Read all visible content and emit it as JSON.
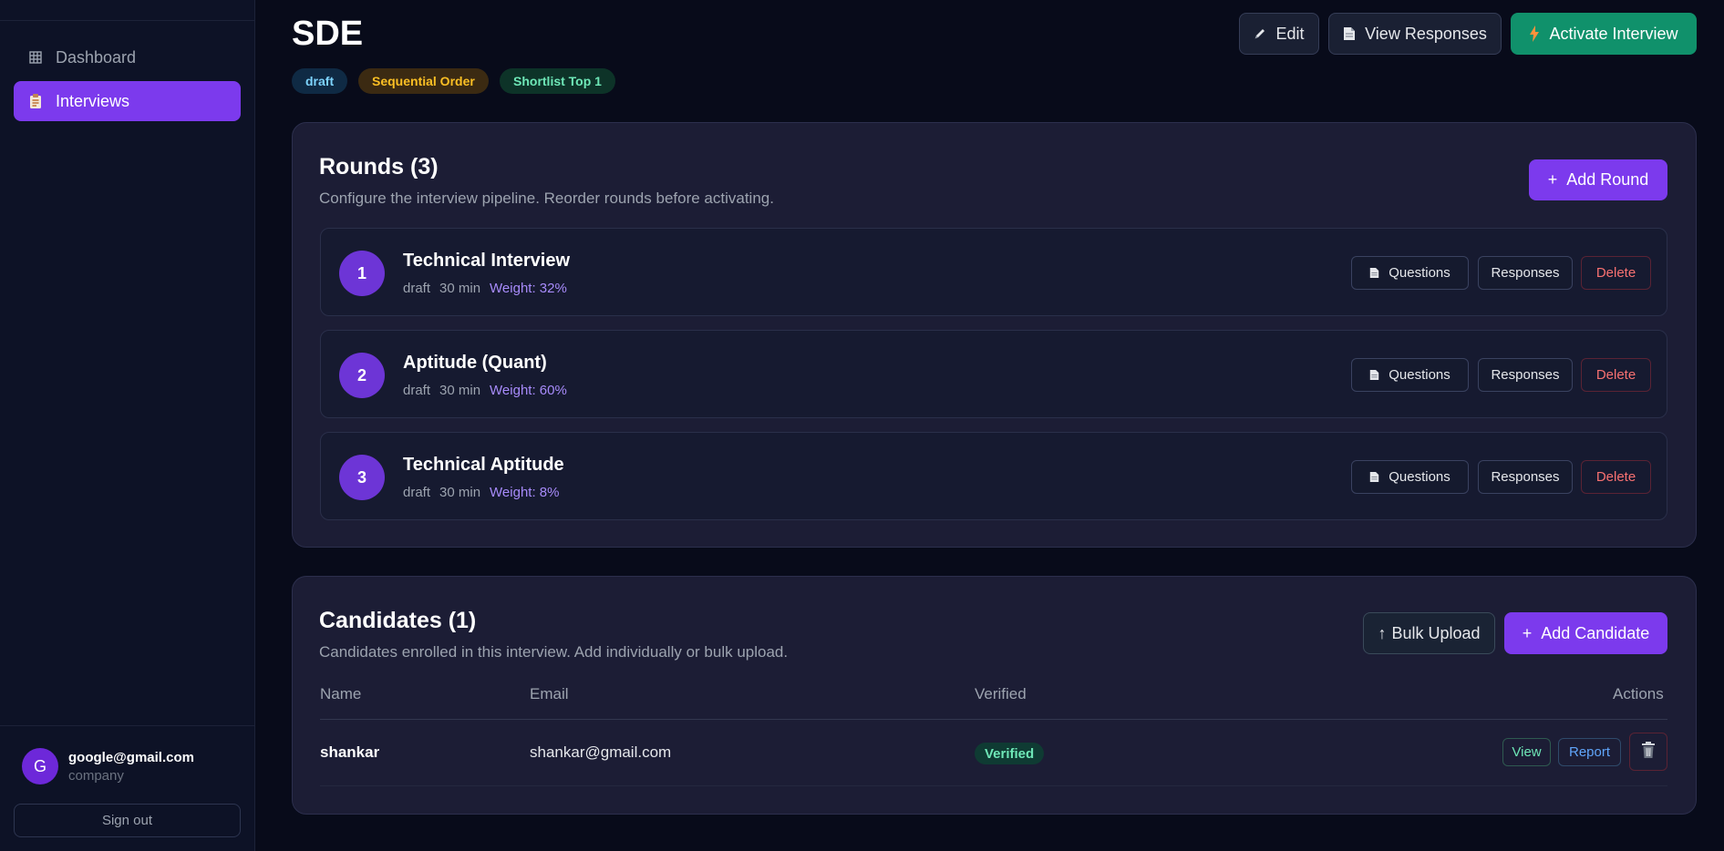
{
  "sidebar": {
    "items": [
      {
        "label": "Dashboard",
        "icon": "grid-icon",
        "active": false
      },
      {
        "label": "Interviews",
        "icon": "clipboard-icon",
        "active": true
      }
    ],
    "user": {
      "initial": "G",
      "email": "google@gmail.com",
      "role": "company"
    },
    "signout_label": "Sign out"
  },
  "header": {
    "title": "SDE",
    "badges": [
      "draft",
      "Sequential Order",
      "Shortlist Top 1"
    ],
    "edit_label": "Edit",
    "view_label": "View Responses",
    "activate_label": "Activate Interview"
  },
  "rounds": {
    "title": "Rounds (3)",
    "subtitle": "Configure the interview pipeline. Reorder rounds before activating.",
    "add_label": "Add Round",
    "add_icon": "+",
    "items": [
      {
        "num": "1",
        "name": "Technical Interview",
        "status": "draft",
        "duration": "30 min",
        "weight": "Weight: 32%"
      },
      {
        "num": "2",
        "name": "Aptitude (Quant)",
        "status": "draft",
        "duration": "30 min",
        "weight": "Weight: 60%"
      },
      {
        "num": "3",
        "name": "Technical Aptitude",
        "status": "draft",
        "duration": "30 min",
        "weight": "Weight: 8%"
      }
    ],
    "questions_label": "Questions",
    "responses_label": "Responses",
    "delete_label": "Delete"
  },
  "candidates": {
    "title": "Candidates (1)",
    "subtitle": "Candidates enrolled in this interview. Add individually or bulk upload.",
    "bulk_label": "Bulk Upload",
    "bulk_icon": "↑",
    "add_label": "Add Candidate",
    "add_icon": "+",
    "columns": [
      "Name",
      "Email",
      "Verified",
      "Actions"
    ],
    "rows": [
      {
        "name": "shankar",
        "email": "shankar@gmail.com",
        "verified": "Verified",
        "view": "View",
        "report": "Report"
      }
    ]
  },
  "colors": {
    "accent": "#7c3aed",
    "success": "#10916b",
    "background": "#080b1a",
    "card": "#1c1d35"
  }
}
